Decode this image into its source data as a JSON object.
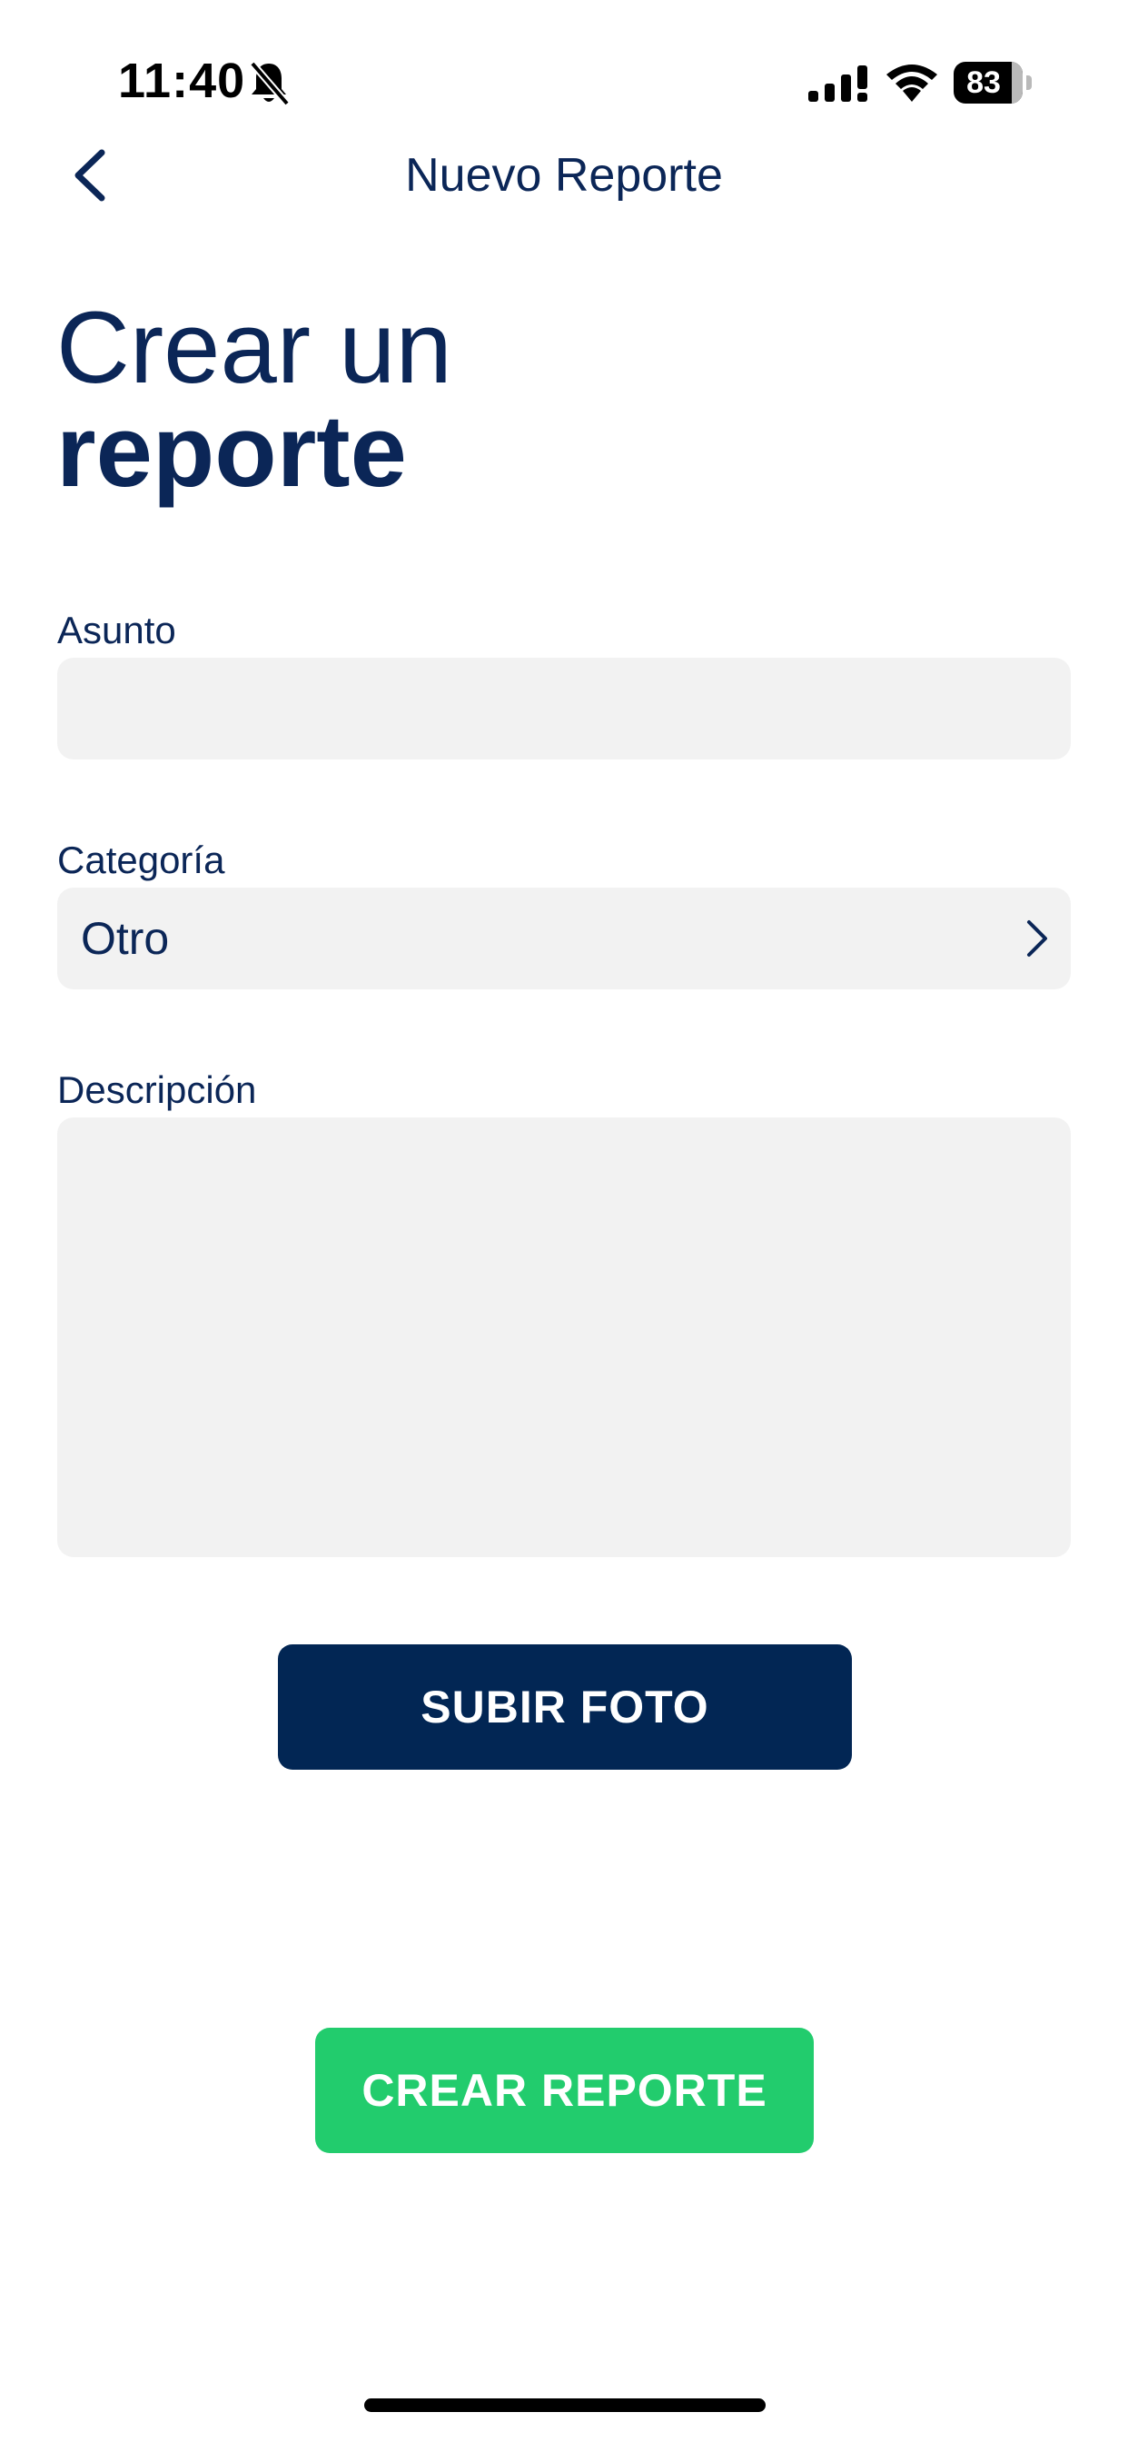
{
  "status_bar": {
    "time": "11:40",
    "battery": "83",
    "icons": [
      "bell-slash-icon",
      "cellular-signal-icon",
      "wifi-icon",
      "battery-icon"
    ]
  },
  "nav": {
    "title": "Nuevo Reporte",
    "back_icon": "chevron-left-icon"
  },
  "heading": {
    "line1": "Crear un",
    "line2": "reporte"
  },
  "form": {
    "subject": {
      "label": "Asunto",
      "value": "",
      "placeholder": ""
    },
    "category": {
      "label": "Categoría",
      "value": "Otro",
      "icon": "chevron-right-icon"
    },
    "description": {
      "label": "Descripción",
      "value": "",
      "placeholder": ""
    }
  },
  "actions": {
    "upload_label": "SUBIR FOTO",
    "create_label": "CREAR REPORTE"
  },
  "colors": {
    "primary_navy": "#022654",
    "text_navy": "#0b2657",
    "accent_green": "#22cc6d",
    "field_background": "#f2f2f2"
  }
}
